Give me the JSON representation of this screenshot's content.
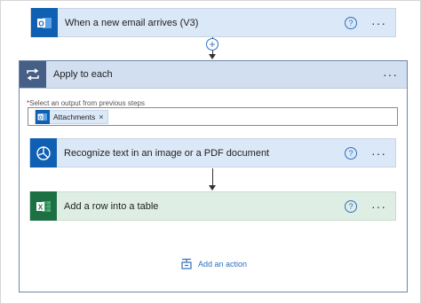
{
  "trigger": {
    "title": "When a new email arrives (V3)",
    "help": "?",
    "more": "···"
  },
  "connector_plus": "+",
  "scope": {
    "title": "Apply to each",
    "more": "···",
    "field_required": "*",
    "field_label": "Select an output from previous steps",
    "chip_label": "Attachments",
    "chip_remove": "×"
  },
  "actions": [
    {
      "title": "Recognize text in an image or a PDF document",
      "help": "?",
      "more": "···"
    },
    {
      "title": "Add a row into a table",
      "help": "?",
      "more": "···"
    }
  ],
  "add_action_label": "Add an action",
  "colors": {
    "outlook": "#0f5fb3",
    "ai_builder": "#0f5fb3",
    "excel": "#1d7044",
    "scope": "#465f86",
    "accent": "#2f6fbf"
  }
}
